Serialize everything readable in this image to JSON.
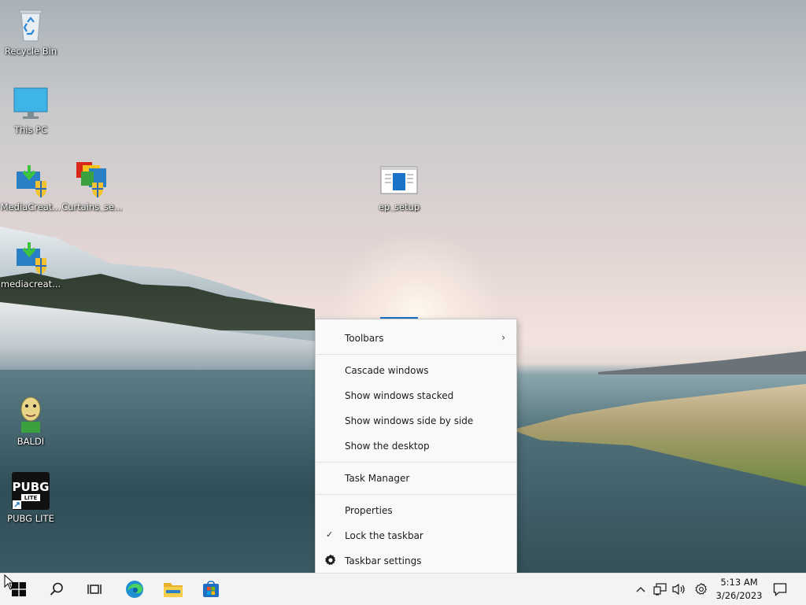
{
  "desktop_icons": {
    "recycle_bin": "Recycle Bin",
    "this_pc": "This PC",
    "media_creation_1": "MediaCreat...",
    "curtains_setup": "Curtains_se...",
    "ep_setup": "ep_setup",
    "media_creation_2": "mediacreat...",
    "baldi": "BALDI",
    "pubg_lite": "PUBG LITE"
  },
  "context_menu": {
    "toolbars": "Toolbars",
    "cascade": "Cascade windows",
    "stacked": "Show windows stacked",
    "side_by_side": "Show windows side by side",
    "show_desktop": "Show the desktop",
    "task_manager": "Task Manager",
    "properties": "Properties",
    "lock_taskbar": "Lock the taskbar",
    "lock_taskbar_checked": true,
    "taskbar_settings": "Taskbar settings"
  },
  "taskbar": {
    "time": "5:13 AM",
    "date": "3/26/2023",
    "pinned": [
      "start-icon",
      "search-icon",
      "task-view-icon",
      "edge-icon",
      "file-explorer-icon",
      "store-icon"
    ]
  },
  "colors": {
    "accent": "#0078d4",
    "taskbar_bg": "#f3f3f3",
    "menu_bg": "#f9f9f9"
  }
}
